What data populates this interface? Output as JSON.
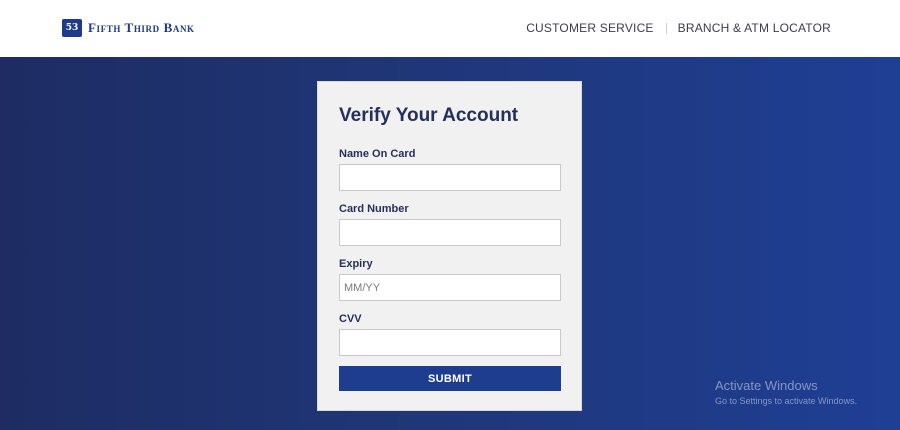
{
  "header": {
    "logo_mark": "53",
    "brand": "Fifth Third Bank",
    "nav": [
      "CUSTOMER SERVICE",
      "BRANCH & ATM LOCATOR"
    ]
  },
  "form": {
    "title": "Verify Your Account",
    "fields": [
      {
        "label": "Name On Card",
        "placeholder": "",
        "value": ""
      },
      {
        "label": "Card Number",
        "placeholder": "",
        "value": ""
      },
      {
        "label": "Expiry",
        "placeholder": "MM/YY",
        "value": ""
      },
      {
        "label": "CVV",
        "placeholder": "",
        "value": ""
      }
    ],
    "submit_label": "SUBMIT"
  },
  "os_watermark": {
    "line1": "Activate Windows",
    "line2": "Go to Settings to activate Windows."
  },
  "colors": {
    "brand": "#1f3a8a",
    "background_start": "#1e2c63",
    "background_end": "#1f3f95",
    "card": "#f1f1f1",
    "button": "#1f3d8e",
    "label_text": "#25305a"
  }
}
